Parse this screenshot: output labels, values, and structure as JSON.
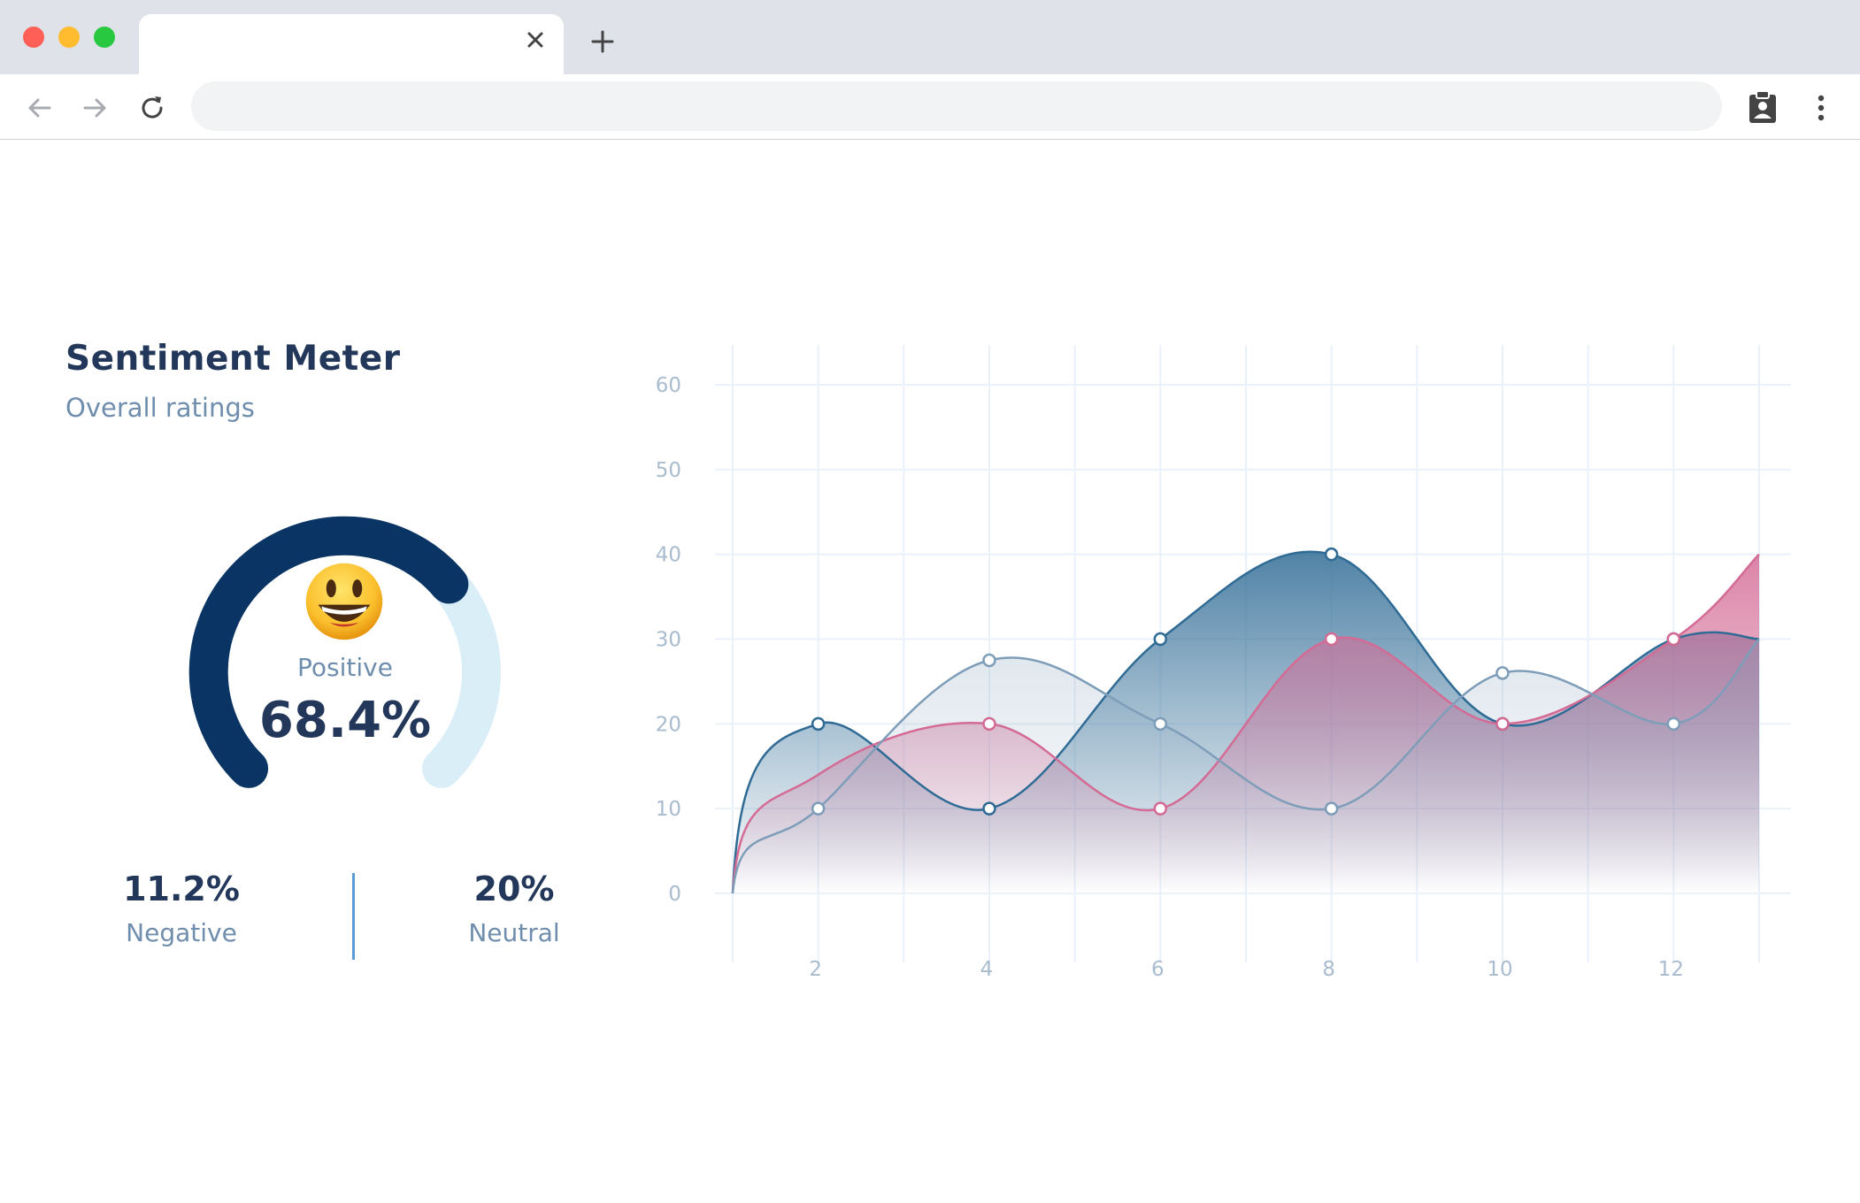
{
  "browser": {
    "traffic_lights": [
      "#ff5f57",
      "#febc2e",
      "#28c840"
    ],
    "tab": {
      "title": ""
    },
    "address": {
      "url": ""
    }
  },
  "card": {
    "title": "Sentiment Meter",
    "subtitle": "Overall ratings",
    "positive": {
      "label": "Positive",
      "value": "68.4%",
      "fraction": 0.684
    },
    "negative": {
      "label": "Negative",
      "value": "11.2%"
    },
    "neutral": {
      "label": "Neutral",
      "value": "20%"
    },
    "colors": {
      "positive": "#0a3463",
      "neutral": "#daeef8"
    }
  },
  "chart_data": {
    "type": "area",
    "x": [
      1,
      2,
      3,
      4,
      5,
      6,
      7,
      8,
      9,
      10,
      11,
      12,
      13
    ],
    "xticks": [
      2,
      4,
      6,
      8,
      10,
      12
    ],
    "yticks": [
      0,
      10,
      20,
      30,
      40,
      50,
      60
    ],
    "xlim": [
      1,
      13
    ],
    "ylim": [
      0,
      60
    ],
    "grid": true,
    "series": [
      {
        "color": "#2f6b95",
        "marker_x": [
          2,
          4,
          6,
          8,
          10,
          12
        ],
        "points": [
          [
            1,
            0
          ],
          [
            2,
            20
          ],
          [
            4,
            10
          ],
          [
            6,
            30
          ],
          [
            8,
            40
          ],
          [
            10,
            20
          ],
          [
            12,
            30
          ],
          [
            13,
            30
          ]
        ]
      },
      {
        "color": "#d46b95",
        "marker_x": [
          4,
          6,
          8,
          10,
          12
        ],
        "points": [
          [
            1,
            0
          ],
          [
            2,
            14
          ],
          [
            4,
            20
          ],
          [
            6,
            10
          ],
          [
            8,
            30
          ],
          [
            10,
            20
          ],
          [
            12,
            30
          ],
          [
            13,
            40
          ]
        ]
      },
      {
        "color": "#7e9db8",
        "marker_x": [
          2,
          4,
          6,
          8,
          10,
          12
        ],
        "points": [
          [
            1,
            0
          ],
          [
            2,
            10
          ],
          [
            4,
            27.5
          ],
          [
            6,
            20
          ],
          [
            8,
            10
          ],
          [
            10,
            26
          ],
          [
            12,
            20
          ],
          [
            13,
            30
          ]
        ]
      }
    ]
  }
}
